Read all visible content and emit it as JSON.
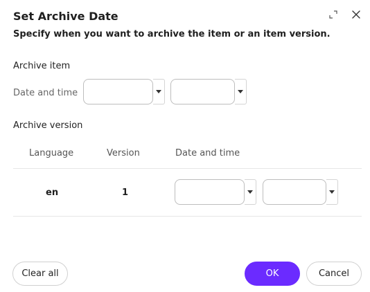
{
  "dialog": {
    "title": "Set Archive Date",
    "subtitle": "Specify when you want to archive the item or an item version.",
    "icons": {
      "expand": "expand-icon",
      "close": "close-icon"
    }
  },
  "archive_item": {
    "section_label": "Archive item",
    "field_label": "Date and time",
    "date_value": "",
    "time_value": ""
  },
  "archive_version": {
    "section_label": "Archive version",
    "columns": [
      "Language",
      "Version",
      "Date and time"
    ],
    "rows": [
      {
        "language": "en",
        "version": "1",
        "date_value": "",
        "time_value": ""
      }
    ]
  },
  "footer": {
    "clear_label": "Clear all",
    "ok_label": "OK",
    "cancel_label": "Cancel"
  },
  "colors": {
    "primary": "#6b2bff",
    "border": "#bdbdbd",
    "divider": "#e6e6e6"
  }
}
